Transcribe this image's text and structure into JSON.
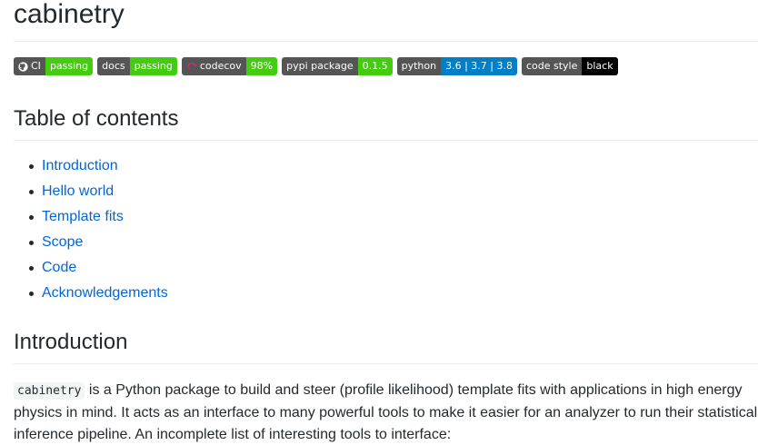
{
  "readme": {
    "title": "cabinetry",
    "badges": [
      {
        "left": "CI",
        "right": "passing",
        "color": "#4c1",
        "has_icon": "github-icon"
      },
      {
        "left": "docs",
        "right": "passing",
        "color": "#4c1"
      },
      {
        "left": "codecov",
        "right": "98%",
        "color": "#4c1",
        "has_icon": "codecov-icon"
      },
      {
        "left": "pypi package",
        "right": "0.1.5",
        "color": "#4c1"
      },
      {
        "left": "python",
        "right": "3.6 | 3.7 | 3.8",
        "color": "#007ec6"
      },
      {
        "left": "code style",
        "right": "black",
        "color": "#000000"
      }
    ],
    "toc_heading": "Table of contents",
    "toc_items": [
      "Introduction",
      "Hello world",
      "Template fits",
      "Scope",
      "Code",
      "Acknowledgements"
    ],
    "intro_heading": "Introduction",
    "intro_code": "cabinetry",
    "intro_text": " is a Python package to build and steer (profile likelihood) template fits with applications in high energy physics in mind. It acts as an interface to many powerful tools to make it easier for an analyzer to run their statistical inference pipeline. An incomplete list of interesting tools to interface:"
  },
  "colors": {
    "link": "#0366d6",
    "badge_left": "#555555",
    "rule": "#eaecef"
  }
}
